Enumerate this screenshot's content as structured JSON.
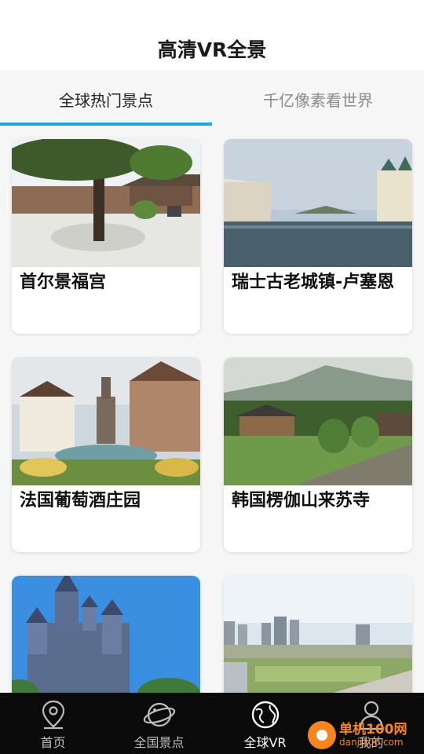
{
  "header": {
    "title": "高清VR全景"
  },
  "tabs": [
    {
      "label": "全球热门景点",
      "active": true
    },
    {
      "label": "千亿像素看世界",
      "active": false
    }
  ],
  "cards": [
    {
      "title": "首尔景福宫"
    },
    {
      "title": "瑞士古老城镇-卢塞恩"
    },
    {
      "title": "法国葡萄酒庄园"
    },
    {
      "title": "韩国楞伽山来苏寺"
    },
    {
      "title": ""
    },
    {
      "title": ""
    }
  ],
  "nav": [
    {
      "label": "首页",
      "icon": "location-pin-icon"
    },
    {
      "label": "全国景点",
      "icon": "planet-icon"
    },
    {
      "label": "全球VR",
      "icon": "globe-icon",
      "active": true
    },
    {
      "label": "我的",
      "icon": "user-icon"
    }
  ],
  "watermark": {
    "line1": "单机100网",
    "line2": "danji100.com"
  },
  "colors": {
    "accent": "#1aa7d9",
    "nav_bg": "#0b0b0b",
    "watermark": "#f5861f"
  }
}
